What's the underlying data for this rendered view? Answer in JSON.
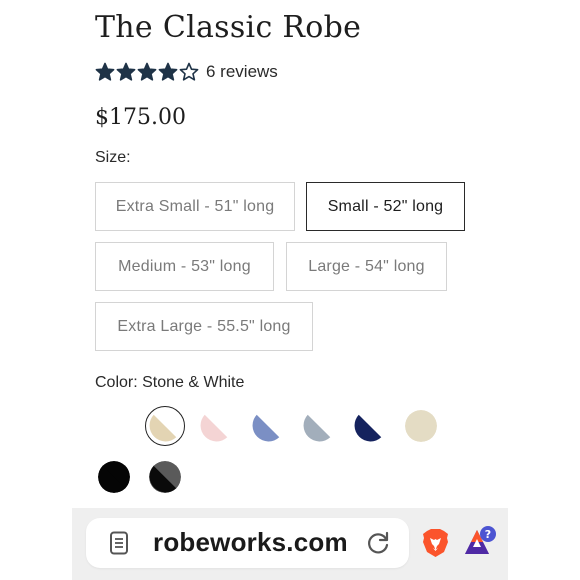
{
  "product": {
    "title": "The Classic Robe",
    "rating": 4,
    "rating_max": 5,
    "reviews_label": "6 reviews",
    "price": "$175.00"
  },
  "size": {
    "label": "Size:",
    "options": [
      {
        "label": "Extra Small - 51\" long",
        "selected": false
      },
      {
        "label": "Small - 52\" long",
        "selected": true
      },
      {
        "label": "Medium - 53\" long",
        "selected": false
      },
      {
        "label": "Large - 54\" long",
        "selected": false
      },
      {
        "label": "Extra Large - 55.5\" long",
        "selected": false
      }
    ]
  },
  "color": {
    "label": "Color: Stone & White",
    "swatches": [
      {
        "name": "stone-white",
        "color": "#e3d4b3",
        "accent": "#ffffff",
        "selected": true
      },
      {
        "name": "blush",
        "color": "#f4d4d4",
        "accent": "#ffffff",
        "selected": false
      },
      {
        "name": "periwinkle",
        "color": "#7b8fc4",
        "accent": "#ffffff",
        "selected": false
      },
      {
        "name": "grey-blue",
        "color": "#a2aebb",
        "accent": "#ffffff",
        "selected": false
      },
      {
        "name": "navy",
        "color": "#15235e",
        "accent": "#ffffff",
        "selected": false
      },
      {
        "name": "cream",
        "color": "#e4dcc4",
        "accent": "#e4dcc4",
        "selected": false
      },
      {
        "name": "black",
        "color": "#050505",
        "accent": "#050505",
        "selected": false
      },
      {
        "name": "black-grey",
        "color": "#0a0a0a",
        "accent": "#5a5a5a",
        "selected": false
      }
    ]
  },
  "browser": {
    "url": "robeworks.com",
    "badge_count": "?",
    "page_icon": "document-icon",
    "reload_icon": "reload-icon",
    "brave_icon": "brave-lion-icon",
    "rewards_icon": "brave-rewards-icon"
  },
  "colors": {
    "star": "#1f3347",
    "brave_orange": "#fb542b",
    "rewards_purple": "#662d91",
    "badge_blue": "#4c54d2"
  }
}
